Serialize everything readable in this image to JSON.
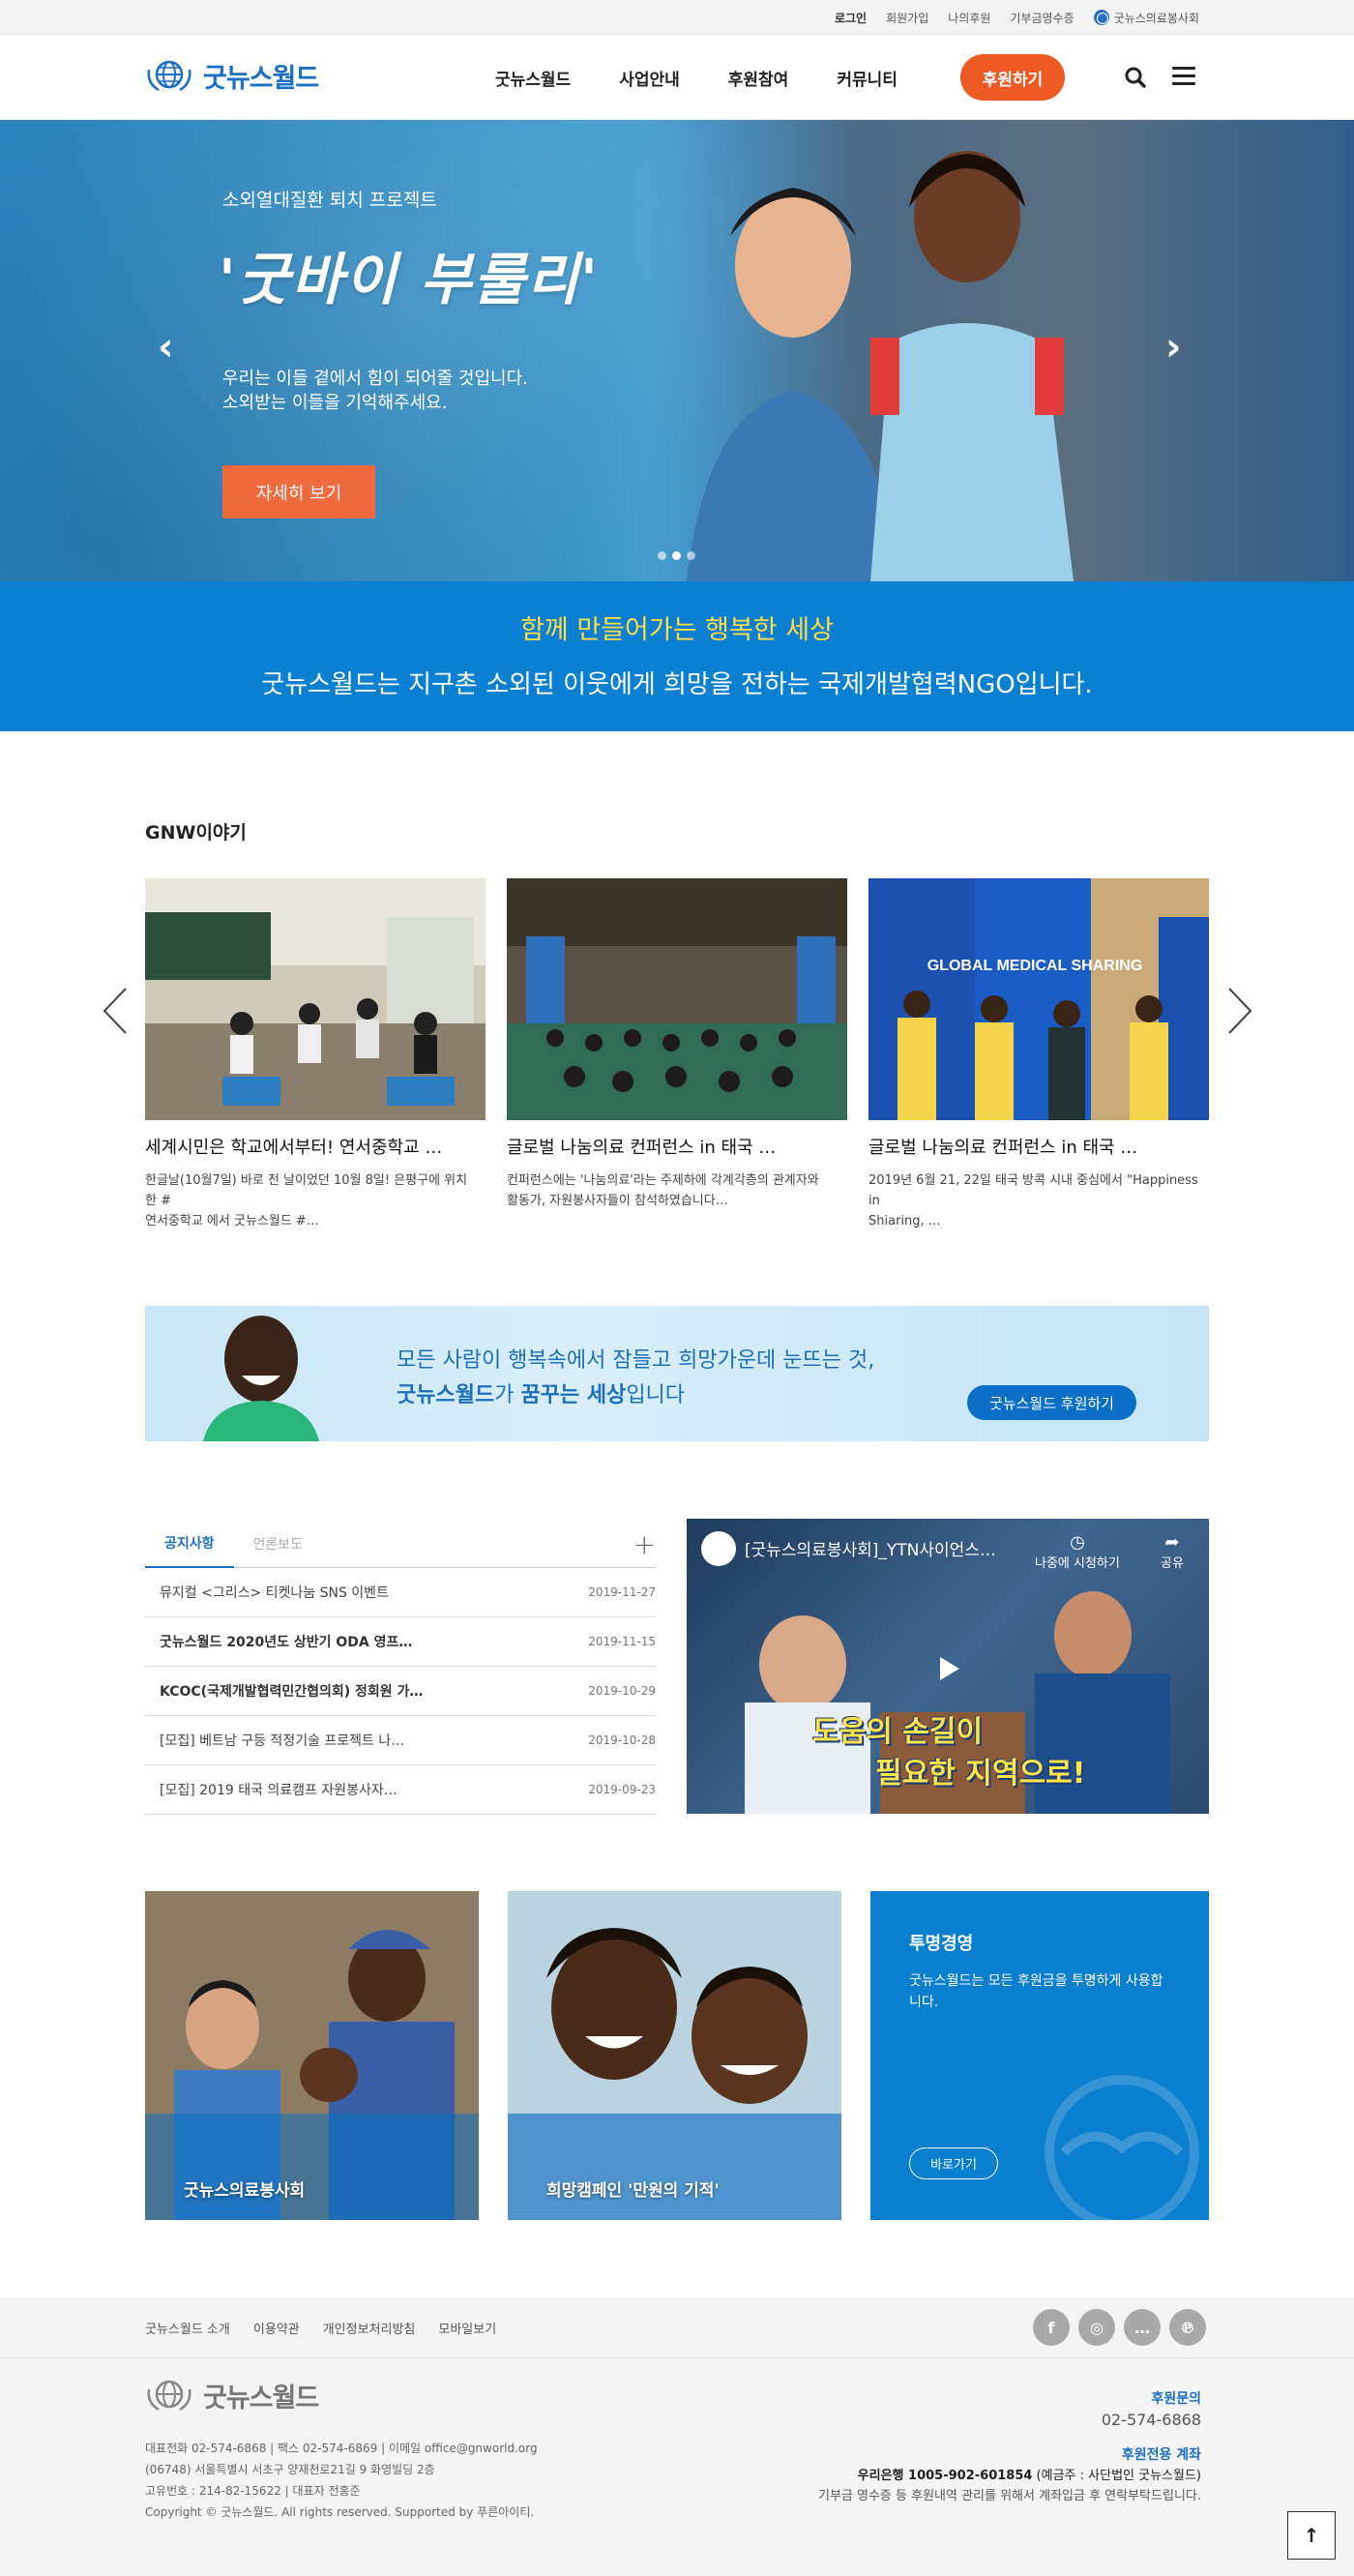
{
  "topbar": {
    "links": [
      "로그인",
      "회원가입",
      "나의후원",
      "기부금영수증"
    ],
    "org_link": "굿뉴스의료봉사회"
  },
  "header": {
    "logo_text": "굿뉴스월드",
    "nav": [
      "굿뉴스월드",
      "사업안내",
      "후원참여",
      "커뮤니티"
    ],
    "donate_label": "후원하기",
    "search_icon": "search-icon",
    "menu_icon": "hamburger-menu-icon"
  },
  "hero": {
    "kicker": "소외열대질환 퇴치 프로젝트",
    "title": "'굿바이 부룰리'",
    "desc_line1": "우리는 이들 곁에서 힘이 되어줄 것입니다.",
    "desc_line2": "소외받는 이들을 기억해주세요.",
    "more_label": "자세히 보기",
    "active_slide": 2,
    "slide_count": 3
  },
  "mission": {
    "line1": "함께 만들어가는 행복한 세상",
    "line2": "굿뉴스월드는 지구촌 소외된 이웃에게 희망을 전하는 국제개발협력NGO입니다."
  },
  "stories": {
    "title": "GNW이야기",
    "cards": [
      {
        "title": "세계시민은 학교에서부터! 연서중학교 …",
        "summary_line1": " 한글날(10월7일) 바로 전 날이었던 10월 8일! 은평구에 위치한 #",
        "summary_line2": "연서중학교 에서 굿뉴스월드 #…"
      },
      {
        "title": "글로벌 나눔의료 컨퍼런스 in 태국 …",
        "summary_line1": "컨퍼런스에는 '나눔의료'라는 주제하에 각계각층의 관계자와",
        "summary_line2": "활동가, 자원봉사자들이 참석하였습니다…"
      },
      {
        "title": "글로벌 나눔의료 컨퍼런스 in 태국 …",
        "summary_line1": "2019년 6월 21, 22일 태국 방콕 시내 중심에서 \"Happiness in",
        "summary_line2": "Shiaring, …"
      }
    ],
    "card3_sign": "GLOBAL MEDICAL SHARING"
  },
  "banner": {
    "line1": "모든 사람이 행복속에서 잠들고 희망가운데 눈뜨는 것,",
    "line2_a": "굿뉴스월드",
    "line2_b": "가 ",
    "line2_c": "꿈꾸는 세상",
    "line2_d": "입니다",
    "button": "굿뉴스월드 후원하기"
  },
  "notice": {
    "tabs": [
      "공지사항",
      "언론보도"
    ],
    "rows": [
      {
        "title": "뮤지컬 <그리스> 티켓나눔 SNS 이벤트",
        "date": "2019-11-27"
      },
      {
        "title": "굿뉴스월드 2020년도 상반기 ODA 영프…",
        "date": "2019-11-15"
      },
      {
        "title": "KCOC(국제개발협력민간협의회) 정회원 가…",
        "date": "2019-10-29"
      },
      {
        "title": "[모집] 베트남 구등 적정기술 프로젝트 나…",
        "date": "2019-10-28"
      },
      {
        "title": "[모집] 2019 태국 의료캠프 자원봉사자…",
        "date": "2019-09-23"
      }
    ]
  },
  "video": {
    "title": "[굿뉴스의료봉사회]_YTN사이언스…",
    "watch_later": "나중에 시청하기",
    "share": "공유",
    "caption1": "도움의 손길이",
    "caption2": "필요한 지역으로!"
  },
  "tiles": {
    "t1": "굿뉴스의료봉사회",
    "t2": "희망캠페인 '만원의 기적'",
    "t3_title": "투명경영",
    "t3_desc": "굿뉴스월드는 모든 후원금을 투명하게 사용합니다.",
    "t3_button": "바로가기"
  },
  "footer": {
    "links": [
      "굿뉴스월드 소개",
      "이용약관",
      "개인정보처리방침",
      "모바일보기"
    ],
    "sns": [
      "f",
      "◎",
      "…",
      "℗"
    ],
    "logo_text": "굿뉴스월드",
    "info_line1": "대표전화 02-574-6868  |  팩스 02-574-6869  |  이메일 office@gnworld.org",
    "info_line2": "(06748) 서울특별시 서초구 양재천로21길 9 화영빌딩 2층",
    "info_line3": "고유번호 : 214-82-15622  |  대표자 전홍준",
    "info_line4": "Copyright © 굿뉴스월드. All rights reserved. Supported by 푸른아이티.",
    "contact_label": "후원문의",
    "contact_tel": "02-574-6868",
    "account_label": "후원전용 계좌",
    "account_bank": "우리은행 1005-902-601854",
    "account_holder": " (예금주 : 사단법인 굿뉴스월드)",
    "account_note": "기부금 영수증 등 후원내역 관리를 위해서 계좌입금 후 연락부탁드립니다.",
    "top_button": "↑"
  },
  "colors": {
    "brand_blue": "#0b80d2",
    "accent_orange": "#ef5a24",
    "mission_yellow": "#ffdc45"
  }
}
